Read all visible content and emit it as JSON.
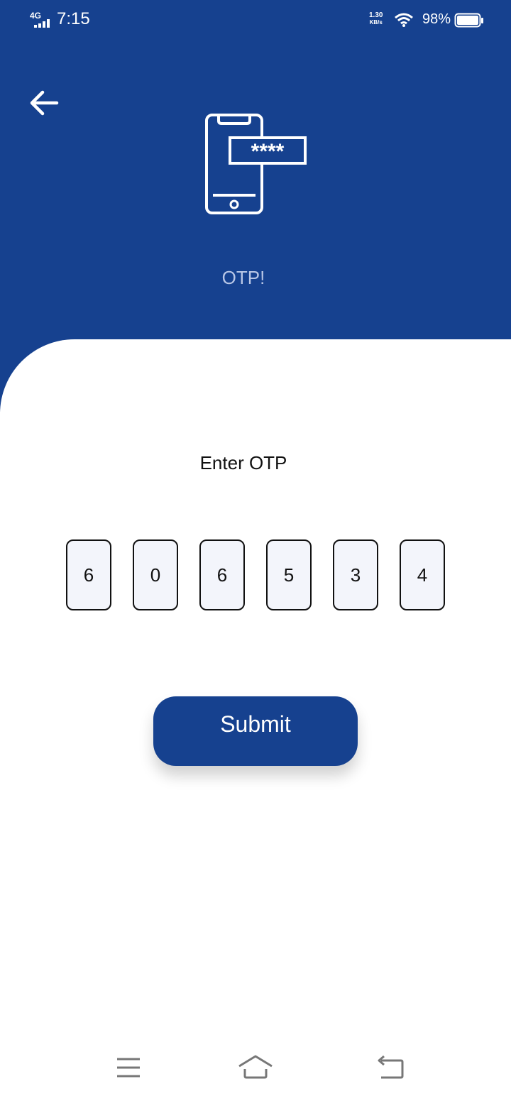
{
  "status_bar": {
    "network": "4G",
    "time": "7:15",
    "speed_value": "1.30",
    "speed_unit": "KB/s",
    "battery": "98%"
  },
  "header": {
    "title": "OTP!",
    "icon": "phone-password-icon",
    "background_color": "#16418f"
  },
  "form": {
    "label": "Enter OTP",
    "digits": [
      "6",
      "0",
      "6",
      "5",
      "3",
      "4"
    ],
    "submit_label": "Submit"
  },
  "nav_bar": {
    "icons": [
      "menu-icon",
      "home-icon",
      "back-icon"
    ]
  }
}
